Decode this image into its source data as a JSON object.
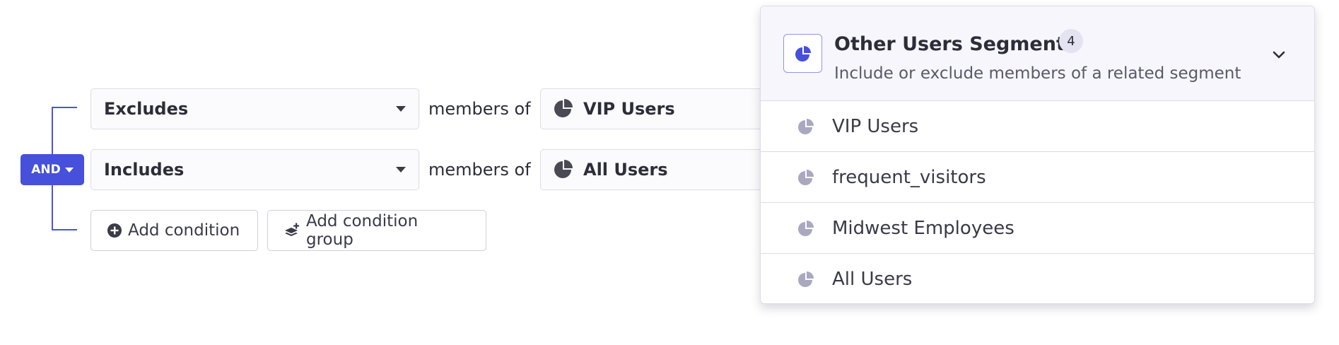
{
  "builder": {
    "logic_label": "AND",
    "connector_text": "members of",
    "conditions": [
      {
        "operator": "Excludes",
        "segment": "VIP Users"
      },
      {
        "operator": "Includes",
        "segment": "All Users"
      }
    ],
    "add_condition_label": "Add condition",
    "add_condition_group_label": "Add condition group"
  },
  "dropdown": {
    "title": "Other Users Segments",
    "count": "4",
    "subtitle": "Include or exclude members of a related segment",
    "items": [
      {
        "label": "VIP Users",
        "icon": "segment-pie-icon"
      },
      {
        "label": "frequent_visitors",
        "icon": "segment-pie-icon"
      },
      {
        "label": "Midwest Employees",
        "icon": "segment-pie-icon"
      },
      {
        "label": "All Users",
        "icon": "segment-pie-icon"
      }
    ]
  },
  "colors": {
    "accent": "#4650db",
    "segment_icon_dark": "#4a4a55",
    "segment_icon_light": "#a9a8c0",
    "header_bg": "#f6f6fc"
  }
}
